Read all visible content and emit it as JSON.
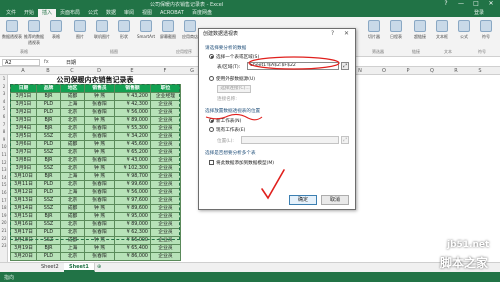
{
  "window": {
    "title": "公司保暖内衣销售记录表 - Excel",
    "controls": [
      "?",
      "—",
      "□",
      "✕"
    ]
  },
  "ribbon": {
    "tabs": [
      "文件",
      "开始",
      "插入",
      "页面布局",
      "公式",
      "数据",
      "审阅",
      "视图",
      "ACROBAT",
      "百度网盘",
      "登录"
    ],
    "active_tab": "插入",
    "buttons": [
      "数据透视表",
      "推荐的数据透视表",
      "表格",
      "图片",
      "联机图片",
      "形状",
      "SmartArt",
      "屏幕截图",
      "应用商店",
      "推荐的图表",
      "Power View",
      "折线图",
      "柱形图",
      "盈亏",
      "切片器",
      "日程表",
      "超链接",
      "文本框",
      "公式",
      "符号"
    ],
    "groups": [
      "表格",
      "插图",
      "应用程序",
      "图表",
      "报告",
      "迷你图",
      "筛选器",
      "链接",
      "文本",
      "符号"
    ]
  },
  "formula_bar": {
    "name_box": "A2",
    "fx": "fx",
    "value": "日期"
  },
  "columns": [
    "A",
    "B",
    "C",
    "D",
    "E",
    "F",
    "G",
    "H",
    "I",
    "J",
    "K",
    "L",
    "M",
    "N",
    "O",
    "P",
    "Q",
    "R",
    "S",
    "T"
  ],
  "rows": [
    "1",
    "2",
    "3",
    "4",
    "5",
    "6",
    "7",
    "8",
    "9",
    "10",
    "11",
    "12",
    "13",
    "14",
    "15",
    "16",
    "17",
    "18",
    "19",
    "20",
    "21",
    "22",
    "23"
  ],
  "sheet": {
    "title": "公司保暖内衣销售记录表",
    "headers": [
      "日期",
      "品牌",
      "地区",
      "销售员",
      "销售额",
      "职位"
    ],
    "rows": [
      [
        "3月1日",
        "BJR",
        "成都",
        "钟 燕",
        "¥ 43,200",
        "企业经理"
      ],
      [
        "3月1日",
        "PLD",
        "上海",
        "张春阳",
        "¥ 42,300",
        "企业员"
      ],
      [
        "3月2日",
        "PLD",
        "北京",
        "张春阳",
        "¥ 56,000",
        "企业员"
      ],
      [
        "3月3日",
        "BJR",
        "北京",
        "钟 燕",
        "¥ 89,000",
        "企业员"
      ],
      [
        "3月4日",
        "BJR",
        "北京",
        "张春阳",
        "¥ 55,300",
        "企业员"
      ],
      [
        "3月5日",
        "SSZ",
        "北京",
        "张春阳",
        "¥ 34,200",
        "企业员"
      ],
      [
        "3月6日",
        "PLD",
        "成都",
        "钟 燕",
        "¥ 45,600",
        "企业员"
      ],
      [
        "3月7日",
        "SSZ",
        "北京",
        "钟 燕",
        "¥ 65,200",
        "企业员"
      ],
      [
        "3月8日",
        "BJR",
        "北京",
        "张春阳",
        "¥ 43,000",
        "企业员"
      ],
      [
        "3月9日",
        "SSZ",
        "北京",
        "钟 燕",
        "¥ 102,300",
        "企业员"
      ],
      [
        "3月10日",
        "BJR",
        "上海",
        "钟 燕",
        "¥ 98,700",
        "企业员"
      ],
      [
        "3月11日",
        "PLD",
        "北京",
        "张春阳",
        "¥ 99,600",
        "企业员"
      ],
      [
        "3月12日",
        "PLD",
        "上海",
        "张春阳",
        "¥ 56,000",
        "企业员"
      ],
      [
        "3月13日",
        "SSZ",
        "北京",
        "张春阳",
        "¥ 97,600",
        "企业员"
      ],
      [
        "3月14日",
        "SSZ",
        "成都",
        "钟 燕",
        "¥ 89,600",
        "企业员"
      ],
      [
        "3月15日",
        "BJR",
        "成都",
        "钟 燕",
        "¥ 95,000",
        "企业员"
      ],
      [
        "3月16日",
        "SSZ",
        "北京",
        "张春阳",
        "¥ 89,000",
        "企业员"
      ],
      [
        "3月17日",
        "PLD",
        "北京",
        "张春阳",
        "¥ 62,300",
        "企业员"
      ],
      [
        "3月18日",
        "SSZ",
        "成都",
        "钟 燕",
        "¥ 56,000",
        "企业员"
      ],
      [
        "3月19日",
        "BJR",
        "上海",
        "钟 燕",
        "¥ 65,400",
        "企业员"
      ],
      [
        "3月20日",
        "PLD",
        "北京",
        "张春阳",
        "¥ 86,000",
        "企业员"
      ]
    ]
  },
  "sheet_tabs": [
    "Sheet2",
    "Sheet1"
  ],
  "active_sheet": "Sheet1",
  "status": "指向",
  "dialog": {
    "title": "创建数据透视表",
    "help": "?",
    "close": "✕",
    "section_source": "请选择要分析的数据",
    "opt_select_table": "选择一个表或区域(S)",
    "label_table_range": "表/区域(T):",
    "table_range_value": "Sheet1!$A$2:$F$22",
    "opt_external": "使用外部数据源(U)",
    "btn_choose_connection": "选择连接(C)...",
    "label_connection": "连接名称:",
    "section_location": "选择放置数据透视表的位置",
    "opt_new_sheet": "新工作表(N)",
    "opt_existing_sheet": "现有工作表(E)",
    "label_location": "位置(L):",
    "section_multi": "选择是否想要分析多个表",
    "chk_data_model": "将此数据添加到数据模型(M)",
    "ok": "确定",
    "cancel": "取消"
  },
  "watermark": {
    "site": "jb51.net",
    "brand": "脚本之家"
  },
  "colors": {
    "excel_green": "#217346",
    "header_green": "#12a152",
    "cell_green": "#b7e2b8",
    "annotation_red": "#e0201d"
  }
}
